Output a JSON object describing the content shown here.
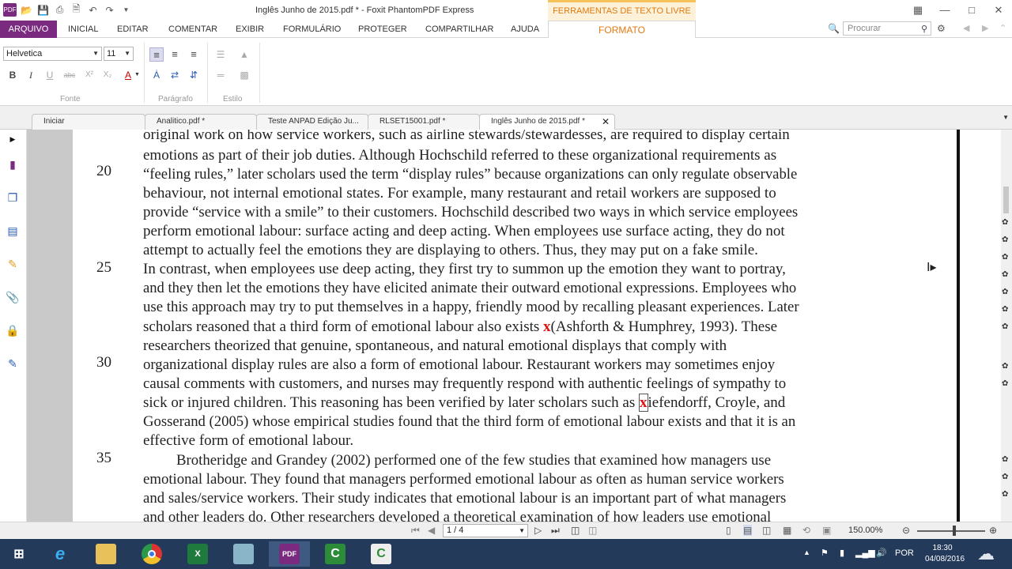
{
  "window": {
    "title": "Inglês Junho de 2015.pdf * - Foxit PhantomPDF Express",
    "context_tools": "FERRAMENTAS DE TEXTO LIVRE"
  },
  "ribbon_tabs": [
    "ARQUIVO",
    "INICIAL",
    "EDITAR",
    "COMENTAR",
    "EXIBIR",
    "FORMULÁRIO",
    "PROTEGER",
    "COMPARTILHAR",
    "AJUDA"
  ],
  "active_tab": "FORMATO",
  "search": {
    "placeholder": "Procurar"
  },
  "format": {
    "font": "Helvetica",
    "size": "11",
    "group_fonte": "Fonte",
    "group_paragrafo": "Parágrafo",
    "group_estilo": "Estilo"
  },
  "doc_tabs": [
    "Iniciar",
    "Analitico.pdf *",
    "Teste ANPAD Edição Ju...",
    "RLSET15001.pdf *",
    "Inglês Junho de 2015.pdf *"
  ],
  "document": {
    "line_numbers": [
      "20",
      "25",
      "30",
      "35"
    ],
    "lines": [
      "original work on how service workers, such as airline stewards/stewardesses, are required to display certain",
      "emotions as part of their job duties. Although Hochschild referred to these organizational requirements as",
      "“feeling rules,” later scholars used the term “display rules” because organizations can only regulate observable",
      "behaviour, not internal emotional states. For example, many restaurant and retail workers are supposed to",
      "provide “service with a smile” to their customers. Hochschild described two ways in which service employees",
      "perform emotional labour: surface acting and deep acting. When employees use surface acting, they do not",
      "attempt to actually feel the emotions they are displaying to others. Thus, they may put on a fake smile.",
      "In contrast, when employees use deep acting, they first try to summon up the emotion they want to portray,",
      "and they then let the emotions they have elicited animate their outward emotional expressions. Employees who",
      "use this approach may try to put themselves in a happy, friendly mood by recalling pleasant experiences. Later",
      "scholars reasoned that a third form of emotional labour also exists ",
      "researchers theorized that genuine, spontaneous, and natural emotional displays that comply with",
      "organizational display rules are also a form of emotional labour. Restaurant workers may sometimes enjoy",
      "causal comments with customers, and nurses may frequently respond with authentic feelings of sympathy to",
      "sick or injured children. This reasoning has been verified by later scholars such as ",
      "Gosserand (2005) whose empirical studies found that the third form of emotional labour exists and that it is an",
      "effective form of emotional labour.",
      "Brotheridge and Grandey (2002) performed one of the few studies that examined how managers use",
      "emotional labour. They found that managers performed emotional labour as often as human service workers",
      "and sales/service workers. Their study indicates that emotional labour is an important part of what managers",
      "and other leaders do. Other researchers developed a theoretical examination of how leaders use emotional"
    ],
    "line11_tail": "(Ashforth & Humphrey, 1993). These",
    "line15_tail": "iefendorff, Croyle, and",
    "mark_x": "x"
  },
  "status": {
    "page": "1 / 4",
    "zoom": "150.00%"
  },
  "taskbar": {
    "lang": "POR",
    "time": "18:30",
    "date": "04/08/2016",
    "apps": [
      "start",
      "internet-explorer",
      "file-explorer",
      "chrome",
      "excel",
      "stickies",
      "foxit-pdf",
      "camtasia",
      "camtasia-recorder"
    ]
  }
}
